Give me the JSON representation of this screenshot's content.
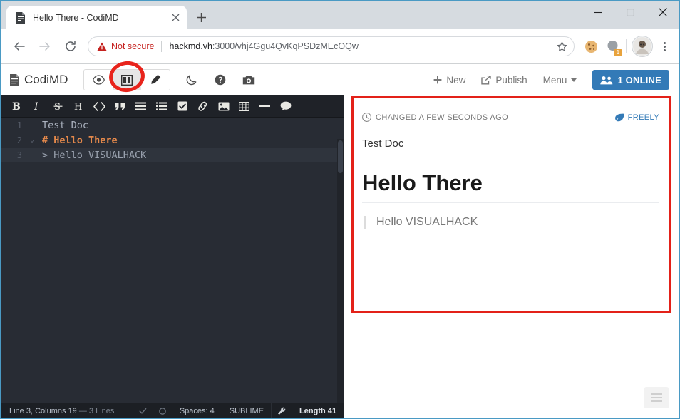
{
  "browser": {
    "tab": {
      "title": "Hello There - CodiMD",
      "favicon_icon": "document-icon",
      "close_icon": "close-icon"
    },
    "new_tab_label": "+",
    "window_controls": {
      "minimize": "minimize-icon",
      "maximize": "maximize-icon",
      "close": "close-icon"
    },
    "nav": {
      "back_icon": "back-arrow-icon",
      "forward_icon": "forward-arrow-icon",
      "reload_icon": "reload-icon"
    },
    "omnibox": {
      "security_label": "Not secure",
      "security_icon": "warning-triangle-icon",
      "url_host": "hackmd.vh",
      "url_rest": ":3000/vhj4Ggu4QvKqPSDzMEcOQw",
      "url_full": "hackmd.vh:3000/vhj4Ggu4QvKqPSDzMEcOQw",
      "bookmark_icon": "star-icon"
    },
    "extensions": [
      {
        "icon": "cookie-icon",
        "badge": ""
      },
      {
        "icon": "extension-circle-icon",
        "badge": "1"
      }
    ],
    "profile_icon": "avatar-icon",
    "menu_icon": "three-dot-menu-icon"
  },
  "app": {
    "brand": {
      "label": "CodiMD",
      "icon": "document-icon"
    },
    "view_modes": [
      {
        "name": "view-mode-preview",
        "icon": "eye-icon",
        "active": false
      },
      {
        "name": "view-mode-both",
        "icon": "columns-icon",
        "active": true
      },
      {
        "name": "view-mode-edit",
        "icon": "pencil-icon",
        "active": false
      }
    ],
    "extra_buttons": [
      {
        "name": "night-mode-button",
        "icon": "moon-icon"
      },
      {
        "name": "help-button",
        "icon": "question-circle-icon"
      },
      {
        "name": "snapshot-button",
        "icon": "camera-icon"
      }
    ],
    "actions": [
      {
        "label": "New",
        "icon": "plus-icon"
      },
      {
        "label": "Publish",
        "icon": "external-link-icon"
      },
      {
        "label": "Menu",
        "icon": "caret-down-icon"
      }
    ],
    "online": {
      "label": "1 ONLINE",
      "icon": "users-icon",
      "color": "#337ab7"
    }
  },
  "editor": {
    "toolbar": [
      {
        "name": "bold-button",
        "glyph": "B"
      },
      {
        "name": "italic-button",
        "glyph": "I"
      },
      {
        "name": "strikethrough-button",
        "glyph": "S"
      },
      {
        "name": "heading-button",
        "glyph": "H"
      },
      {
        "name": "code-button",
        "glyph": "</>"
      },
      {
        "name": "quote-button",
        "glyph": "”"
      },
      {
        "name": "unordered-list-button",
        "glyph": "☰"
      },
      {
        "name": "ordered-list-button",
        "glyph": "☷"
      },
      {
        "name": "check-list-button",
        "glyph": "☑"
      },
      {
        "name": "link-button",
        "glyph": "🔗"
      },
      {
        "name": "image-button",
        "glyph": "🖼"
      },
      {
        "name": "table-button",
        "glyph": "▦"
      },
      {
        "name": "horizontal-rule-button",
        "glyph": "—"
      },
      {
        "name": "comment-button",
        "glyph": "💬"
      }
    ],
    "lines": [
      {
        "number": "1",
        "fold": "",
        "text": "Test Doc",
        "style": "plain",
        "active": false
      },
      {
        "number": "2",
        "fold": "⌄",
        "text": "# Hello There",
        "style": "head",
        "active": false
      },
      {
        "number": "3",
        "fold": "",
        "text": "> Hello VISUALHACK",
        "style": "quote",
        "active": true
      }
    ],
    "status": {
      "cursor": "Line 3, Columns 19",
      "lines": "— 3 Lines",
      "save_icon": "check-icon",
      "sync_icon": "circle-icon",
      "indent": "Spaces: 4",
      "keymap": "SUBLIME",
      "settings_icon": "wrench-icon",
      "length": "Length 41"
    }
  },
  "preview": {
    "changed_label": "CHANGED A FEW SECONDS AGO",
    "changed_icon": "clock-icon",
    "permission_label": "FREELY",
    "permission_icon": "leaf-icon",
    "paragraph": "Test Doc",
    "heading": "Hello There",
    "blockquote": "Hello VISUALHACK",
    "toc_icon": "toc-hamburger-icon"
  },
  "annotations": {
    "highlight_color": "#e32119",
    "rect_target": "preview-pane",
    "ellipse_target": "view-mode-both-button"
  }
}
